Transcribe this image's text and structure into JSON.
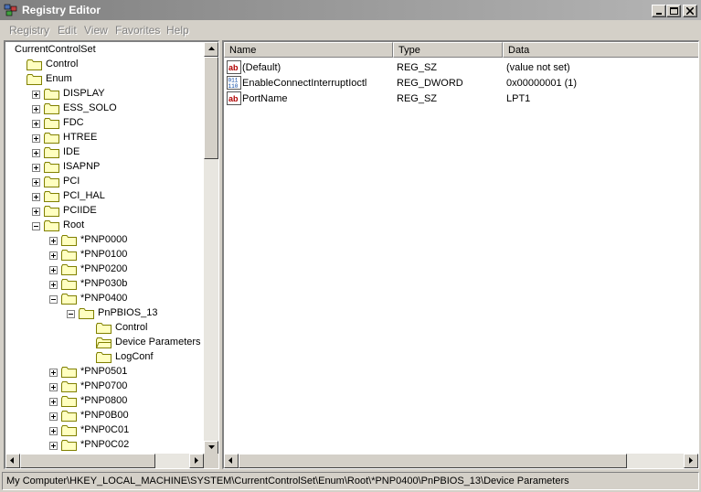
{
  "window": {
    "title": "Registry Editor"
  },
  "menu": [
    "Registry",
    "Edit",
    "View",
    "Favorites",
    "Help"
  ],
  "tree": [
    {
      "label": "CurrentControlSet",
      "level": 0,
      "toggle": "none"
    },
    {
      "label": "Control",
      "level": 1,
      "toggle": "none"
    },
    {
      "label": "Enum",
      "level": 1,
      "toggle": "none"
    },
    {
      "label": "DISPLAY",
      "level": 2,
      "toggle": "plus"
    },
    {
      "label": "ESS_SOLO",
      "level": 2,
      "toggle": "plus"
    },
    {
      "label": "FDC",
      "level": 2,
      "toggle": "plus"
    },
    {
      "label": "HTREE",
      "level": 2,
      "toggle": "plus"
    },
    {
      "label": "IDE",
      "level": 2,
      "toggle": "plus"
    },
    {
      "label": "ISAPNP",
      "level": 2,
      "toggle": "plus"
    },
    {
      "label": "PCI",
      "level": 2,
      "toggle": "plus"
    },
    {
      "label": "PCI_HAL",
      "level": 2,
      "toggle": "plus"
    },
    {
      "label": "PCIIDE",
      "level": 2,
      "toggle": "plus"
    },
    {
      "label": "Root",
      "level": 2,
      "toggle": "minus"
    },
    {
      "label": "*PNP0000",
      "level": 3,
      "toggle": "plus"
    },
    {
      "label": "*PNP0100",
      "level": 3,
      "toggle": "plus"
    },
    {
      "label": "*PNP0200",
      "level": 3,
      "toggle": "plus"
    },
    {
      "label": "*PNP030b",
      "level": 3,
      "toggle": "plus"
    },
    {
      "label": "*PNP0400",
      "level": 3,
      "toggle": "minus"
    },
    {
      "label": "PnPBIOS_13",
      "level": 4,
      "toggle": "minus"
    },
    {
      "label": "Control",
      "level": 5,
      "toggle": "none"
    },
    {
      "label": "Device Parameters",
      "level": 5,
      "toggle": "none",
      "selected": true
    },
    {
      "label": "LogConf",
      "level": 5,
      "toggle": "none"
    },
    {
      "label": "*PNP0501",
      "level": 3,
      "toggle": "plus"
    },
    {
      "label": "*PNP0700",
      "level": 3,
      "toggle": "plus"
    },
    {
      "label": "*PNP0800",
      "level": 3,
      "toggle": "plus"
    },
    {
      "label": "*PNP0B00",
      "level": 3,
      "toggle": "plus"
    },
    {
      "label": "*PNP0C01",
      "level": 3,
      "toggle": "plus"
    },
    {
      "label": "*PNP0C02",
      "level": 3,
      "toggle": "plus"
    }
  ],
  "columns": {
    "name": "Name",
    "type": "Type",
    "data": "Data"
  },
  "values": [
    {
      "name": "(Default)",
      "type": "REG_SZ",
      "data": "(value not set)",
      "icon": "string-value-icon"
    },
    {
      "name": "EnableConnectInterruptIoctl",
      "type": "REG_DWORD",
      "data": "0x00000001 (1)",
      "icon": "binary-value-icon"
    },
    {
      "name": "PortName",
      "type": "REG_SZ",
      "data": "LPT1",
      "icon": "string-value-icon"
    }
  ],
  "status": "My Computer\\HKEY_LOCAL_MACHINE\\SYSTEM\\CurrentControlSet\\Enum\\Root\\*PNP0400\\PnPBIOS_13\\Device Parameters",
  "colors": {
    "title_start": "#808080",
    "title_end": "#b5b5b5",
    "chrome": "#d4d0c8",
    "folder": "#ffffc0"
  }
}
